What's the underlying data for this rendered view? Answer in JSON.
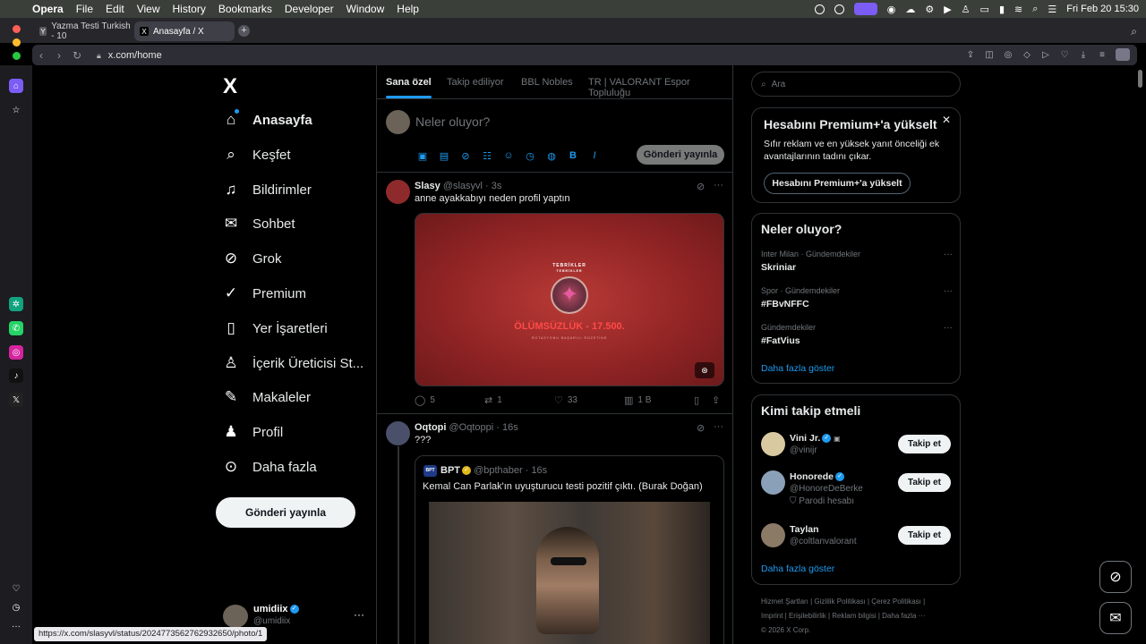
{
  "menubar": {
    "app": "Opera",
    "items": [
      "File",
      "Edit",
      "View",
      "History",
      "Bookmarks",
      "Developer",
      "Window",
      "Help"
    ],
    "datetime": "Fri Feb 20  15:30"
  },
  "browser": {
    "tabs": [
      {
        "title": "Yazma Testi Turkish - 10",
        "icon": "Y"
      },
      {
        "title": "Anasayfa / X",
        "icon": "X"
      }
    ],
    "url": "x.com/home",
    "status_url": "https://x.com/slasyvl/status/2024773562762932650/photo/1"
  },
  "nav": {
    "logo": "X",
    "items": [
      {
        "label": "Anasayfa",
        "icon": "home-icon"
      },
      {
        "label": "Keşfet",
        "icon": "search-icon"
      },
      {
        "label": "Bildirimler",
        "icon": "bell-icon"
      },
      {
        "label": "Sohbet",
        "icon": "mail-icon"
      },
      {
        "label": "Grok",
        "icon": "grok-icon"
      },
      {
        "label": "Premium",
        "icon": "verified-icon"
      },
      {
        "label": "Yer İşaretleri",
        "icon": "bookmark-icon"
      },
      {
        "label": "İçerik Üreticisi St...",
        "icon": "creator-icon"
      },
      {
        "label": "Makaleler",
        "icon": "article-icon"
      },
      {
        "label": "Profil",
        "icon": "person-icon"
      },
      {
        "label": "Daha fazla",
        "icon": "more-icon"
      }
    ],
    "post_button": "Gönderi yayınla",
    "account": {
      "name": "umidiix",
      "handle": "@umidiix"
    }
  },
  "feed": {
    "tabs": [
      "Sana özel",
      "Takip ediliyor",
      "BBL Nobles",
      "TR | VALORANT Espor Topluluğu"
    ],
    "composer": {
      "placeholder": "Neler oluyor?",
      "post_button": "Gönderi yayınla"
    },
    "tweets": [
      {
        "name": "Slasy",
        "handle": "@slasyvl",
        "time": "3s",
        "text": "anne ayakkabıyı neden profil yaptın",
        "media": {
          "line1": "TEBRİKLER",
          "line2": "TEBRİKLER",
          "headline": "ÖLÜMSÜZLÜK - 17.500.",
          "footer": "ROTASYONU BAŞARILI ROZETİNE"
        },
        "replies": "5",
        "reposts": "1",
        "likes": "33",
        "views": "1 B"
      },
      {
        "name": "Oqtopi",
        "handle": "@Oqtoppi",
        "time": "16s",
        "text": "???",
        "quote": {
          "badge": "BPT",
          "name": "BPT",
          "handle": "@bpthaber",
          "time": "16s",
          "text": "Kemal Can Parlak'ın uyuşturucu testi pozitif çıktı. (Burak Doğan)"
        }
      }
    ]
  },
  "right": {
    "search_placeholder": "Ara",
    "premium": {
      "title": "Hesabını Premium+'a yükselt",
      "desc": "Sıfır reklam ve en yüksek yanıt önceliği ek avantajlarının tadını çıkar.",
      "button": "Hesabını Premium+'a yükselt"
    },
    "trends": {
      "title": "Neler oluyor?",
      "items": [
        {
          "meta": "Inter Milan · Gündemdekiler",
          "title": "Skriniar"
        },
        {
          "meta": "Spor · Gündemdekiler",
          "title": "#FBvNFFC"
        },
        {
          "meta": "Gündemdekiler",
          "title": "#FatVius"
        }
      ],
      "show_more": "Daha fazla göster"
    },
    "who_to_follow": {
      "title": "Kimi takip etmeli",
      "items": [
        {
          "name": "Vini Jr.",
          "handle": "@vinijr",
          "extra": "",
          "button": "Takip et"
        },
        {
          "name": "Honorede",
          "handle": "@HonoreDeBerke",
          "extra": "Parodi hesabı",
          "button": "Takip et"
        },
        {
          "name": "Taylan",
          "handle": "@coltlanvalorant",
          "extra": "",
          "button": "Takip et"
        }
      ],
      "show_more": "Daha fazla göster"
    },
    "footer": {
      "line1": "Hizmet Şartları  |  Gizlilik Politikası  |  Çerez Politikası  |",
      "line2": "Imprint  |  Erişilebilirlik  |  Reklam bilgisi  |  Daha fazla ···",
      "line3": "© 2026 X Corp."
    }
  },
  "colors": {
    "accent": "#1d9bf0",
    "border": "#2f3336",
    "muted": "#71767b"
  }
}
